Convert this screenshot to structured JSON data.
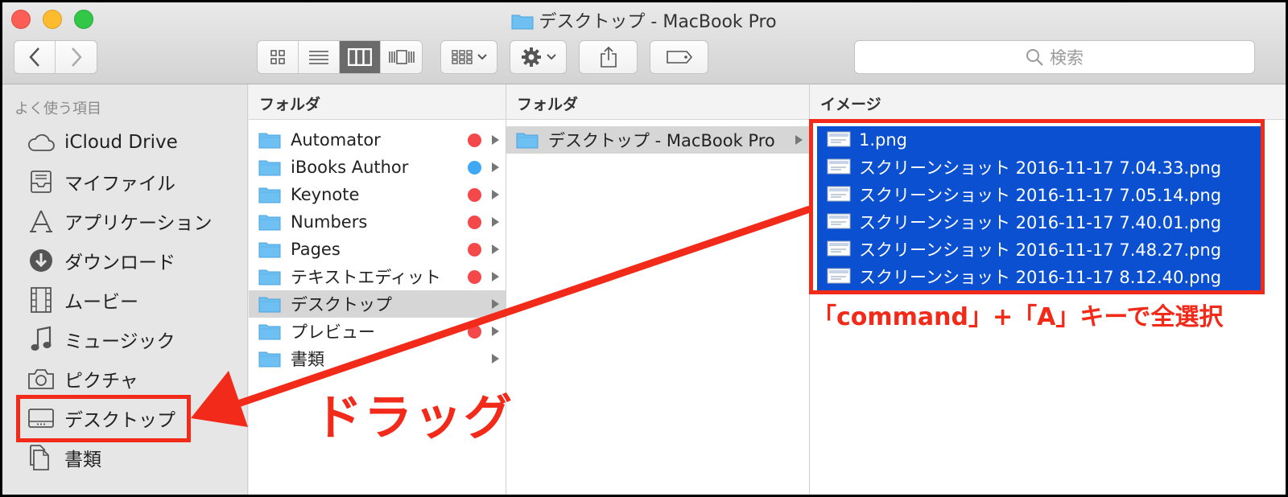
{
  "window": {
    "title": "デスクトップ - MacBook Pro"
  },
  "toolbar": {
    "search_placeholder": "検索"
  },
  "sidebar": {
    "heading": "よく使う項目",
    "items": [
      {
        "label": "iCloud Drive",
        "icon": "cloud-icon",
        "selected": true
      },
      {
        "label": "マイファイル",
        "icon": "inbox-tray-icon",
        "selected": false
      },
      {
        "label": "アプリケーション",
        "icon": "applications-icon",
        "selected": false
      },
      {
        "label": "ダウンロード",
        "icon": "download-icon",
        "selected": false
      },
      {
        "label": "ムービー",
        "icon": "film-icon",
        "selected": false
      },
      {
        "label": "ミュージック",
        "icon": "music-note-icon",
        "selected": false
      },
      {
        "label": "ピクチャ",
        "icon": "camera-icon",
        "selected": false
      },
      {
        "label": "デスクトップ",
        "icon": "desktop-icon",
        "selected": false
      },
      {
        "label": "書類",
        "icon": "document-icon",
        "selected": false
      }
    ]
  },
  "columns": [
    {
      "header": "フォルダ",
      "rows": [
        {
          "name": "Automator",
          "tag": "#f4484a",
          "folder": true
        },
        {
          "name": "iBooks Author",
          "tag": "#3ea8f4",
          "folder": true
        },
        {
          "name": "Keynote",
          "tag": "#f4484a",
          "folder": true
        },
        {
          "name": "Numbers",
          "tag": "#f4484a",
          "folder": true
        },
        {
          "name": "Pages",
          "tag": "#f4484a",
          "folder": true
        },
        {
          "name": "テキストエディット",
          "tag": "#f4484a",
          "folder": true
        },
        {
          "name": "デスクトップ",
          "tag": "",
          "folder": true,
          "selected": true
        },
        {
          "name": "プレビュー",
          "tag": "#f4484a",
          "folder": true
        },
        {
          "name": "書類",
          "tag": "",
          "folder": true
        }
      ]
    },
    {
      "header": "フォルダ",
      "rows": [
        {
          "name": "デスクトップ - MacBook Pro",
          "folder": true,
          "selected": true
        }
      ]
    },
    {
      "header": "イメージ",
      "rows": [
        {
          "name": "1.png"
        },
        {
          "name": "スクリーンショット 2016-11-17 7.04.33.png"
        },
        {
          "name": "スクリーンショット 2016-11-17 7.05.14.png"
        },
        {
          "name": "スクリーンショット 2016-11-17 7.40.01.png"
        },
        {
          "name": "スクリーンショット 2016-11-17 7.48.27.png"
        },
        {
          "name": "スクリーンショット 2016-11-17 8.12.40.png"
        }
      ]
    }
  ],
  "annotations": {
    "select_all_caption": "「command」+「A」キーで全選択",
    "drag_label": "ドラッグ",
    "color": "#f22a1a"
  },
  "colors": {
    "selection_blue": "#0b50d0",
    "folder_blue": "#6fc0f2"
  }
}
